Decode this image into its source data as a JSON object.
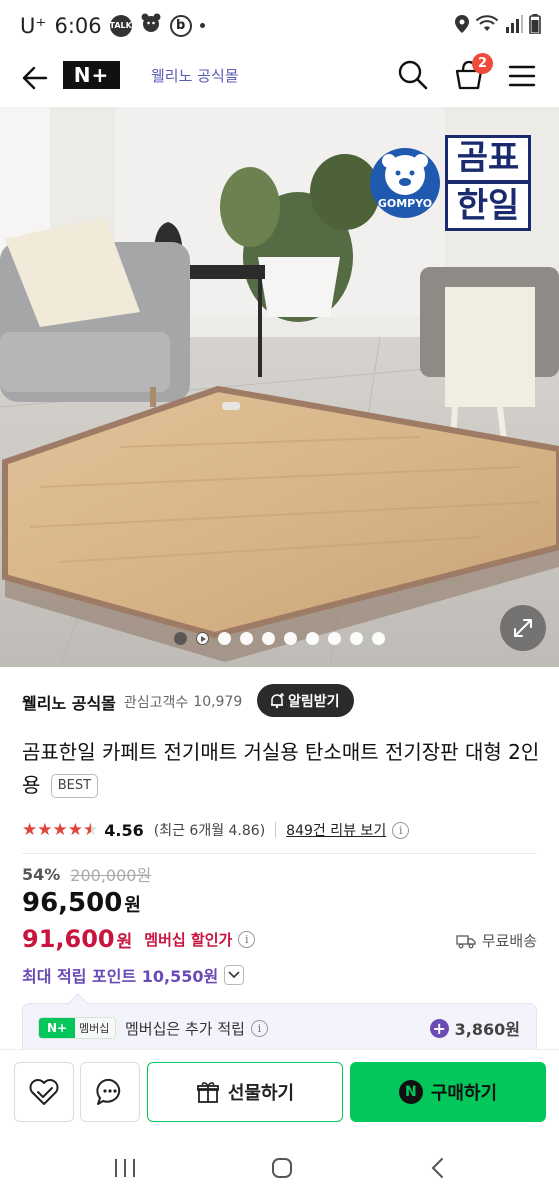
{
  "status_bar": {
    "carrier": "U⁺",
    "time": "6:06",
    "talk_icon_label": "TALK",
    "b_icon_label": "b",
    "icons": [
      "location-icon",
      "wifi-icon",
      "signal-icon",
      "battery-icon"
    ]
  },
  "header": {
    "logo": "N+",
    "store": "웰리노 공식몰",
    "cart_count": "2",
    "accent": "#03c75a"
  },
  "hero": {
    "brand_badge_text_top": "곰표",
    "brand_badge_text_bottom": "한일",
    "brand_badge_sub": "GOMPYO",
    "carousel_total": 10,
    "carousel_active": 1
  },
  "store_row": {
    "name": "웰리노 공식몰",
    "fan_label": "관심고객수",
    "fan_count": "10,979",
    "notify_label": "알림받기"
  },
  "product": {
    "title": "곰표한일 카페트 전기매트 거실용 탄소매트 전기장판 대형 2인용",
    "badge": "BEST",
    "rating": "4.56",
    "rating_stars": 4.5,
    "recent_rating": "(최근 6개월 4.86)",
    "review_link": "849건 리뷰 보기",
    "discount": "54%",
    "original_price": "200,000원",
    "price": "96,500",
    "price_unit": "원",
    "member_price": "91,600",
    "member_unit": "원",
    "member_label": "멤버십 할인가",
    "shipping": "무료배송",
    "points": "최대 적립 포인트 10,550원"
  },
  "membership": {
    "badge_label": "멤버십",
    "badge_logo": "N+",
    "text": "멤버십은 추가 적립",
    "points": "3,860원"
  },
  "actions": {
    "gift_label": "선물하기",
    "buy_label": "구매하기",
    "buy_logo": "N"
  }
}
